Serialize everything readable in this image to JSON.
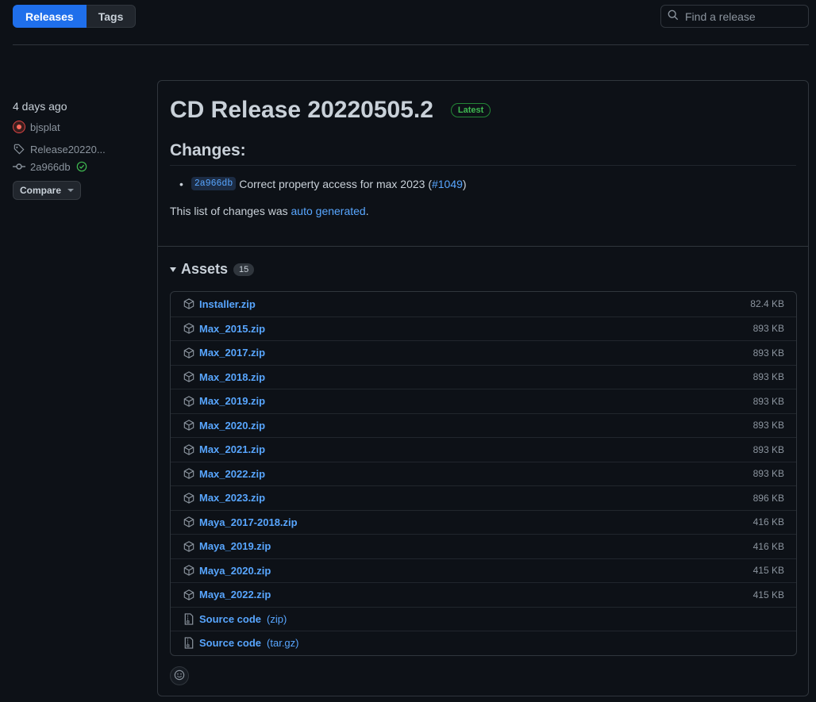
{
  "nav": {
    "releases": "Releases",
    "tags": "Tags"
  },
  "search": {
    "placeholder": "Find a release"
  },
  "sidebar": {
    "when": "4 days ago",
    "author": "bjsplat",
    "tag": "Release20220...",
    "commit": "2a966db",
    "compare": "Compare"
  },
  "release": {
    "title": "CD Release 20220505.2",
    "badge": "Latest",
    "changes_heading": "Changes:",
    "change": {
      "sha": "2a966db",
      "text_before": "Correct property access for max 2023 (",
      "pr": "#1049",
      "text_after": ")"
    },
    "auto": {
      "before": "This list of changes was ",
      "link": "auto generated",
      "after": "."
    }
  },
  "assets": {
    "label": "Assets",
    "count": "15",
    "items": [
      {
        "name": "Installer.zip",
        "size": "82.4 KB"
      },
      {
        "name": "Max_2015.zip",
        "size": "893 KB"
      },
      {
        "name": "Max_2017.zip",
        "size": "893 KB"
      },
      {
        "name": "Max_2018.zip",
        "size": "893 KB"
      },
      {
        "name": "Max_2019.zip",
        "size": "893 KB"
      },
      {
        "name": "Max_2020.zip",
        "size": "893 KB"
      },
      {
        "name": "Max_2021.zip",
        "size": "893 KB"
      },
      {
        "name": "Max_2022.zip",
        "size": "893 KB"
      },
      {
        "name": "Max_2023.zip",
        "size": "896 KB"
      },
      {
        "name": "Maya_2017-2018.zip",
        "size": "416 KB"
      },
      {
        "name": "Maya_2019.zip",
        "size": "416 KB"
      },
      {
        "name": "Maya_2020.zip",
        "size": "415 KB"
      },
      {
        "name": "Maya_2022.zip",
        "size": "415 KB"
      }
    ],
    "source": [
      {
        "name": "Source code",
        "suffix": "(zip)"
      },
      {
        "name": "Source code",
        "suffix": "(tar.gz)"
      }
    ]
  }
}
